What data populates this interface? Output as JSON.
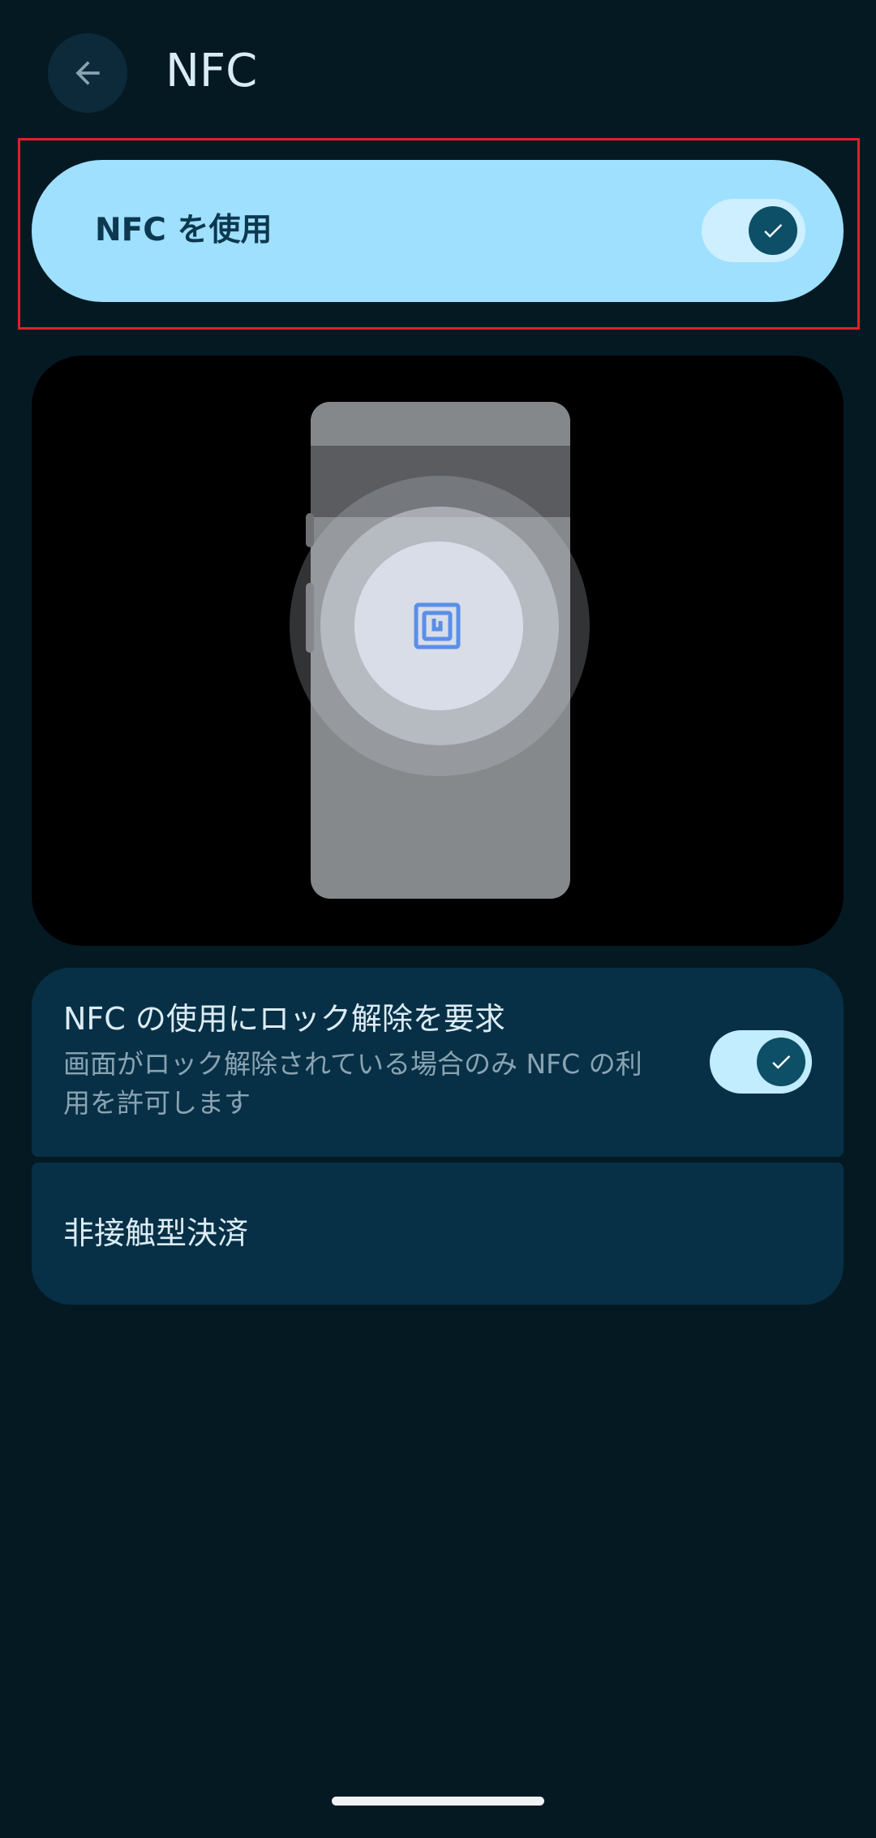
{
  "header": {
    "title": "NFC",
    "back_icon": "arrow-back-icon"
  },
  "nfc_toggle": {
    "label": "NFC を使用",
    "state": "on"
  },
  "illustration": {
    "icon": "nfc-tag-icon"
  },
  "unlock_setting": {
    "title": "NFC の使用にロック解除を要求",
    "description": "画面がロック解除されている場合のみ NFC の利用を許可します",
    "state": "on"
  },
  "payment": {
    "label": "非接触型決済"
  },
  "colors": {
    "background": "#051923",
    "highlight_card": "#9fe0ff",
    "card": "#073046",
    "toggle_thumb": "#0c4f66",
    "annotation_border": "#e0202a",
    "nfc_icon": "#5a8fe8"
  }
}
